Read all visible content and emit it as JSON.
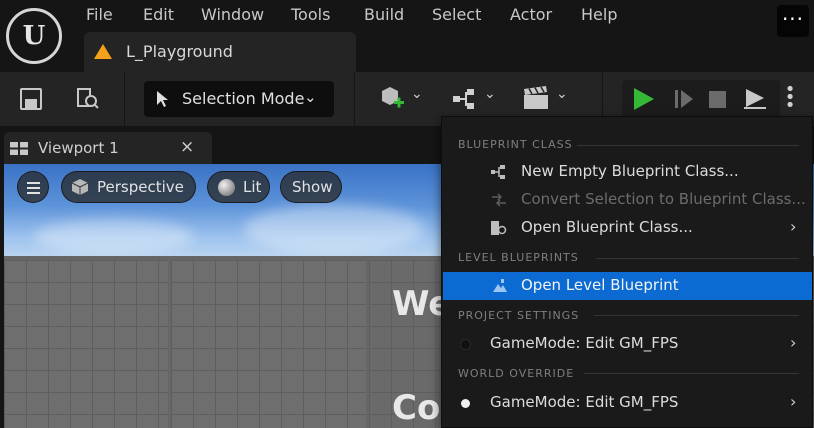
{
  "menubar": {
    "logo_text": "U",
    "items": [
      "File",
      "Edit",
      "Window",
      "Tools",
      "Build",
      "Select",
      "Actor",
      "Help"
    ],
    "more_glyph": "···"
  },
  "level_tab": {
    "label": "L_Playground",
    "icon": "level-warning-icon",
    "icon_color": "#f4a11b"
  },
  "toolbar": {
    "selection_mode_label": "Selection Mode",
    "play_color": "#35b835"
  },
  "viewport_tab": {
    "label": "Viewport 1",
    "close_glyph": "×"
  },
  "viewport": {
    "perspective_label": "Perspective",
    "lit_label": "Lit",
    "show_label": "Show",
    "wall_text_1": "We",
    "wall_text_2": "Co"
  },
  "dropdown": {
    "sections": {
      "blueprint_class": "BLUEPRINT CLASS",
      "level_blueprints": "LEVEL BLUEPRINTS",
      "project_settings": "PROJECT SETTINGS",
      "world_override": "WORLD OVERRIDE"
    },
    "items": {
      "new_empty": "New Empty Blueprint Class...",
      "convert_selection": "Convert Selection to Blueprint Class...",
      "open_class": "Open Blueprint Class...",
      "open_level": "Open Level Blueprint",
      "gamemode_project": "GameMode: Edit GM_FPS",
      "gamemode_world": "GameMode: Edit GM_FPS"
    },
    "highlight_color": "#0b6bd3"
  }
}
